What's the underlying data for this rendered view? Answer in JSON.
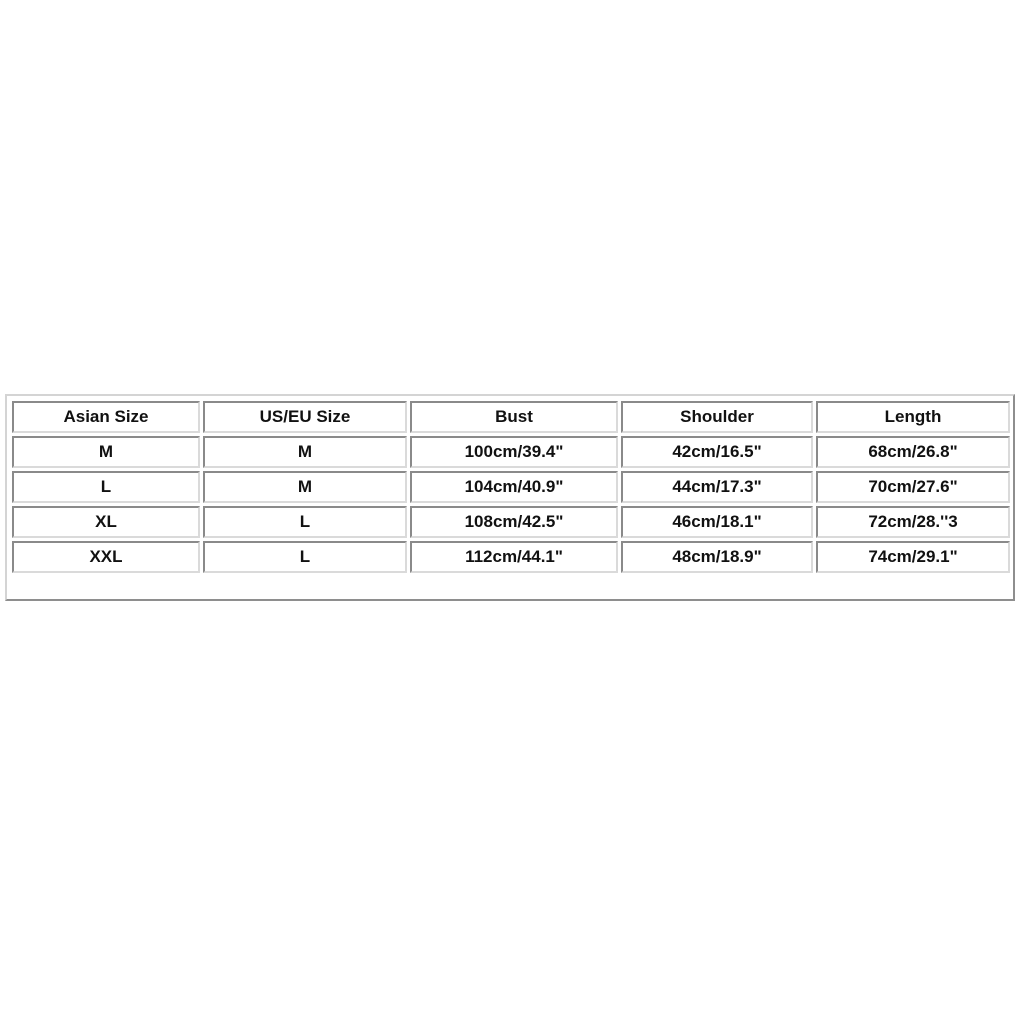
{
  "size_chart": {
    "headers": [
      "Asian Size",
      "US/EU Size",
      "Bust",
      "Shoulder",
      "Length"
    ],
    "rows": [
      [
        "M",
        "M",
        "100cm/39.4\"",
        "42cm/16.5\"",
        "68cm/26.8\""
      ],
      [
        "L",
        "M",
        "104cm/40.9\"",
        "44cm/17.3\"",
        "70cm/27.6\""
      ],
      [
        "XL",
        "L",
        "108cm/42.5\"",
        "46cm/18.1\"",
        "72cm/28.''3"
      ],
      [
        "XXL",
        "L",
        "112cm/44.1\"",
        "48cm/18.9\"",
        "74cm/29.1\""
      ]
    ]
  }
}
